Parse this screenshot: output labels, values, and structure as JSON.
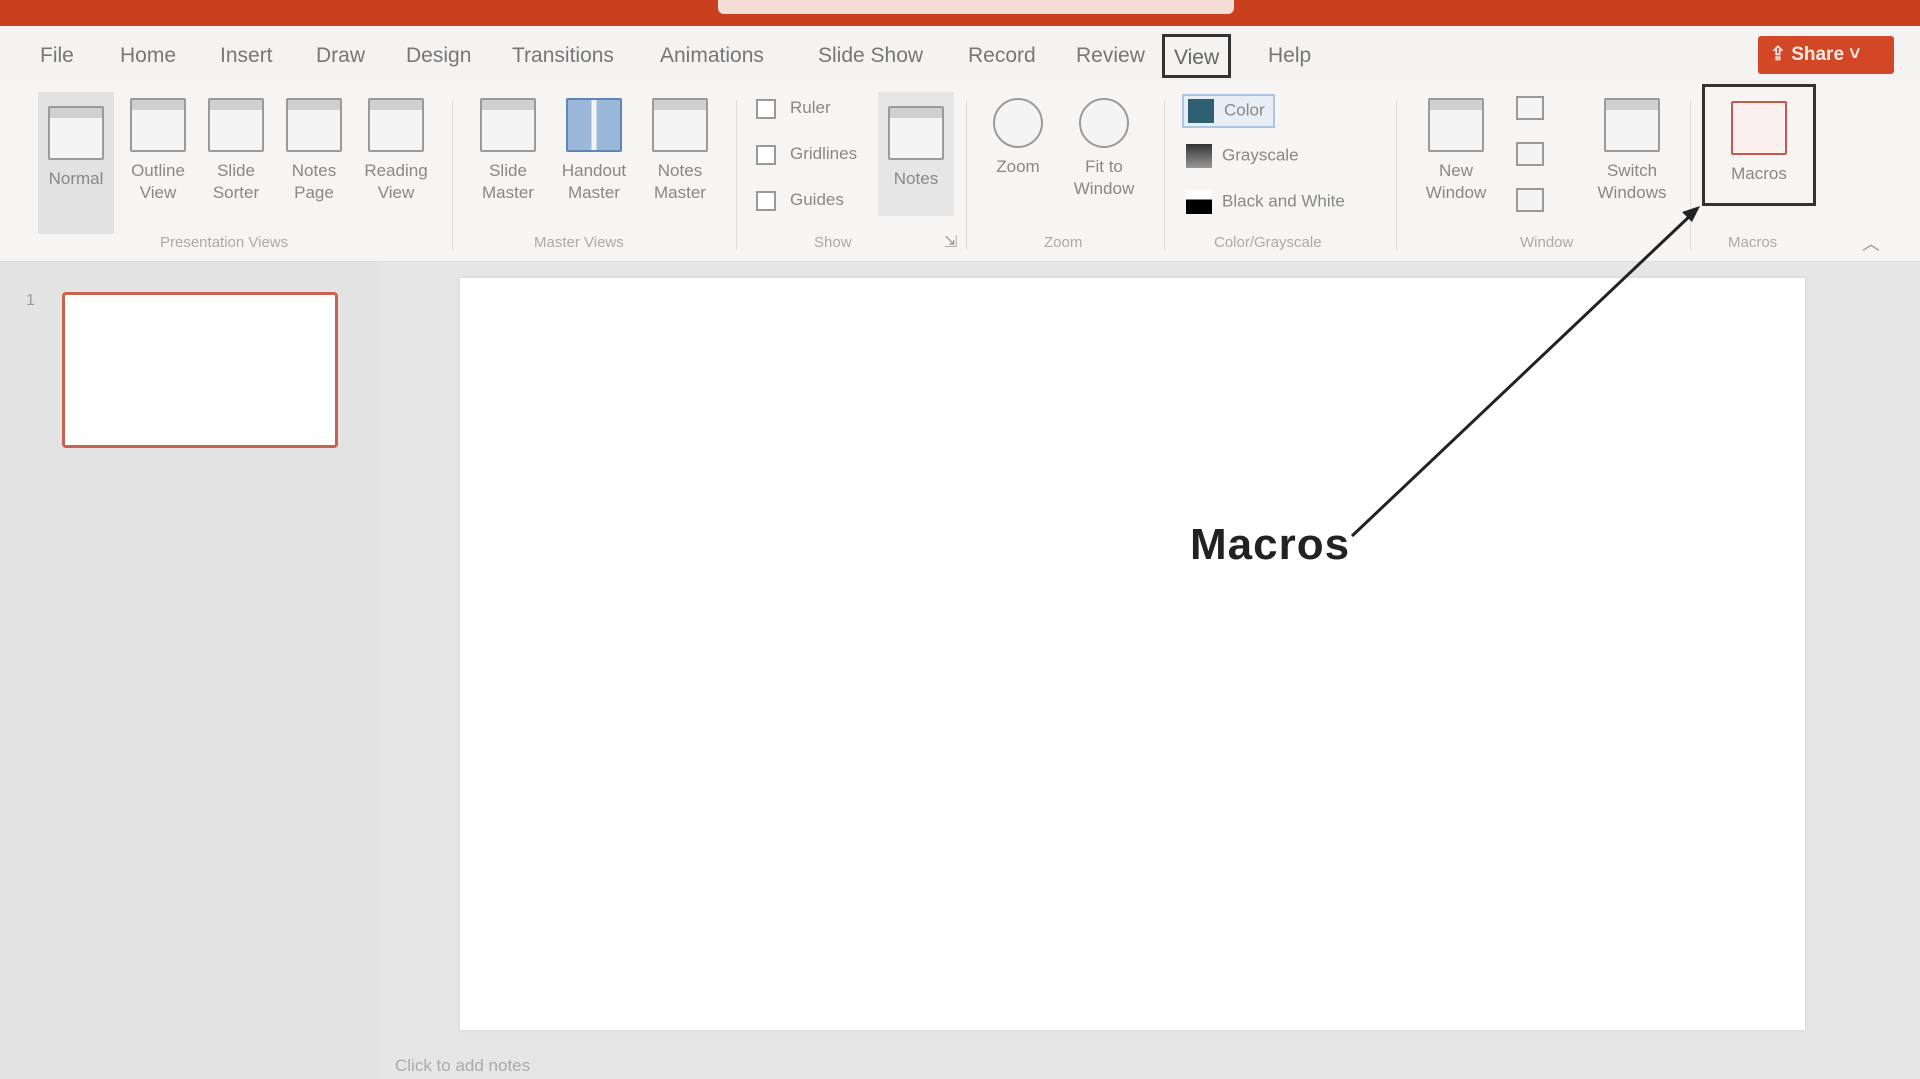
{
  "tabs": [
    {
      "label": "File"
    },
    {
      "label": "Home"
    },
    {
      "label": "Insert"
    },
    {
      "label": "Draw"
    },
    {
      "label": "Design"
    },
    {
      "label": "Transitions"
    },
    {
      "label": "Animations"
    },
    {
      "label": "Slide Show"
    },
    {
      "label": "Record"
    },
    {
      "label": "Review"
    },
    {
      "label": "View",
      "active": true
    },
    {
      "label": "Help"
    }
  ],
  "share": {
    "label": "Share",
    "icon": "share-icon",
    "chevron": "˅"
  },
  "ribbon": {
    "presentation_views": {
      "label": "Presentation Views",
      "buttons": [
        {
          "label": "Normal",
          "icon": "normal-view-icon"
        },
        {
          "label": "Outline View",
          "icon": "outline-view-icon"
        },
        {
          "label": "Slide Sorter",
          "icon": "slide-sorter-icon"
        },
        {
          "label": "Notes Page",
          "icon": "notes-page-icon"
        },
        {
          "label": "Reading View",
          "icon": "reading-view-icon"
        }
      ]
    },
    "master_views": {
      "label": "Master Views",
      "buttons": [
        {
          "label": "Slide Master",
          "icon": "slide-master-icon"
        },
        {
          "label": "Handout Master",
          "icon": "handout-master-icon"
        },
        {
          "label": "Notes Master",
          "icon": "notes-master-icon"
        }
      ]
    },
    "show": {
      "label": "Show",
      "checks": [
        {
          "label": "Ruler",
          "checked": false
        },
        {
          "label": "Gridlines",
          "checked": false
        },
        {
          "label": "Guides",
          "checked": false
        }
      ],
      "notes_button": {
        "label": "Notes",
        "icon": "notes-icon"
      }
    },
    "zoom": {
      "label": "Zoom",
      "buttons": [
        {
          "label": "Zoom",
          "icon": "zoom-icon"
        },
        {
          "label": "Fit to Window",
          "icon": "fit-to-window-icon"
        }
      ]
    },
    "color_grayscale": {
      "label": "Color/Grayscale",
      "options": [
        {
          "label": "Color",
          "swatch": "#2f5f73",
          "selected": true
        },
        {
          "label": "Grayscale",
          "swatch": "#555555"
        },
        {
          "label": "Black and White",
          "swatch": "#000000"
        }
      ]
    },
    "window": {
      "label": "Window",
      "buttons": [
        {
          "label": "New Window",
          "icon": "new-window-icon"
        },
        {
          "label": "Switch Windows",
          "icon": "switch-windows-icon"
        }
      ]
    },
    "macros": {
      "label": "Macros",
      "button": {
        "label": "Macros",
        "icon": "macros-icon"
      }
    }
  },
  "slides": {
    "number": "1"
  },
  "notes_placeholder": "Click to add notes",
  "annotation": {
    "label": "Macros"
  },
  "colors": {
    "titlebar": "#c8401e",
    "share": "#d24726",
    "thumb_border": "#c9624f"
  }
}
